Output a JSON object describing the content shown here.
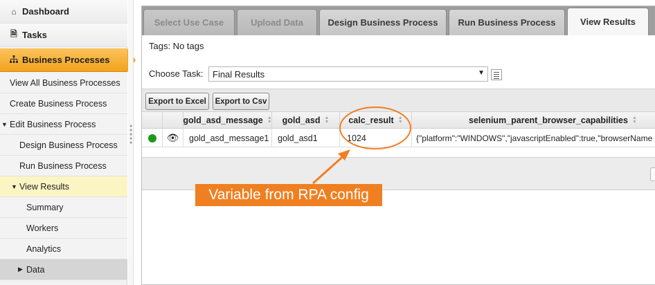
{
  "sidebar": {
    "items": [
      {
        "label": "Dashboard",
        "icon": "home-icon"
      },
      {
        "label": "Tasks",
        "icon": "document-icon"
      },
      {
        "label": "Business Processes",
        "icon": "sitemap-icon"
      },
      {
        "label": "View All Business Processes"
      },
      {
        "label": "Create Business Process"
      },
      {
        "label": "Edit Business Process",
        "expanded": true
      },
      {
        "label": "Design Business Process"
      },
      {
        "label": "Run Business Process"
      },
      {
        "label": "View Results",
        "expanded": true
      },
      {
        "label": "Summary"
      },
      {
        "label": "Workers"
      },
      {
        "label": "Analytics"
      },
      {
        "label": "Data",
        "expanded": false
      }
    ]
  },
  "tabs": [
    {
      "label": "Select Use Case",
      "state": "disabled"
    },
    {
      "label": "Upload Data",
      "state": "disabled"
    },
    {
      "label": "Design Business Process",
      "state": "enabled"
    },
    {
      "label": "Run Business Process",
      "state": "enabled"
    },
    {
      "label": "View Results",
      "state": "active"
    }
  ],
  "tags_text": "Tags: No tags",
  "choose_task": {
    "label": "Choose Task:",
    "value": "Final Results"
  },
  "toolbar": {
    "export_excel": "Export to Excel",
    "export_csv": "Export to Csv"
  },
  "table": {
    "columns": [
      "gold_asd_message",
      "gold_asd",
      "calc_result",
      "selenium_parent_browser_capabilities"
    ],
    "rows": [
      {
        "status": "green",
        "cells": [
          "gold_asd_message1",
          "gold_asd1",
          "1024",
          "{\"platform\":\"WINDOWS\",\"javascriptEnabled\":true,\"browserName"
        ]
      }
    ]
  },
  "annotation": {
    "text": "Variable from RPA config"
  },
  "colors": {
    "accent": "#f2a31c",
    "callout": "#f07f22",
    "status_green": "#1c9a1c",
    "highlight": "#fbf5c4"
  }
}
